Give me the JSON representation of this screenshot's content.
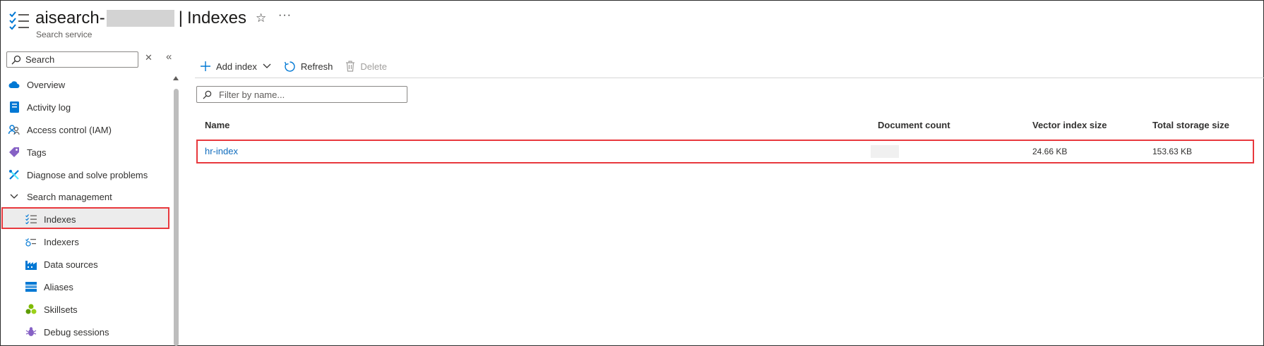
{
  "header": {
    "title_prefix": "aisearch-",
    "title_page": "Indexes",
    "title_separator": "|",
    "subtitle": "Search service",
    "star_icon": "star-icon",
    "more_icon": "ellipsis-icon"
  },
  "sidebar": {
    "search_placeholder": "Search",
    "items": [
      {
        "label": "Overview",
        "icon": "cloud-icon"
      },
      {
        "label": "Activity log",
        "icon": "log-icon"
      },
      {
        "label": "Access control (IAM)",
        "icon": "people-icon"
      },
      {
        "label": "Tags",
        "icon": "tag-icon"
      },
      {
        "label": "Diagnose and solve problems",
        "icon": "wrench-icon"
      },
      {
        "label": "Search management",
        "icon": "chevron-down-icon"
      },
      {
        "label": "Indexes",
        "icon": "list-check-icon",
        "selected": true
      },
      {
        "label": "Indexers",
        "icon": "indexer-icon"
      },
      {
        "label": "Data sources",
        "icon": "factory-icon"
      },
      {
        "label": "Aliases",
        "icon": "stack-icon"
      },
      {
        "label": "Skillsets",
        "icon": "cubes-icon"
      },
      {
        "label": "Debug sessions",
        "icon": "bug-icon"
      }
    ]
  },
  "toolbar": {
    "add_label": "Add index",
    "refresh_label": "Refresh",
    "delete_label": "Delete"
  },
  "filter": {
    "placeholder": "Filter by name..."
  },
  "table": {
    "columns": [
      "Name",
      "Document count",
      "Vector index size",
      "Total storage size"
    ],
    "rows": [
      {
        "name": "hr-index",
        "document_count": "",
        "vector_index_size": "24.66 KB",
        "total_storage_size": "153.63 KB"
      }
    ]
  },
  "colors": {
    "highlight_border": "#e8383d",
    "link": "#0f6cbd",
    "selected_bg": "#ececec"
  }
}
